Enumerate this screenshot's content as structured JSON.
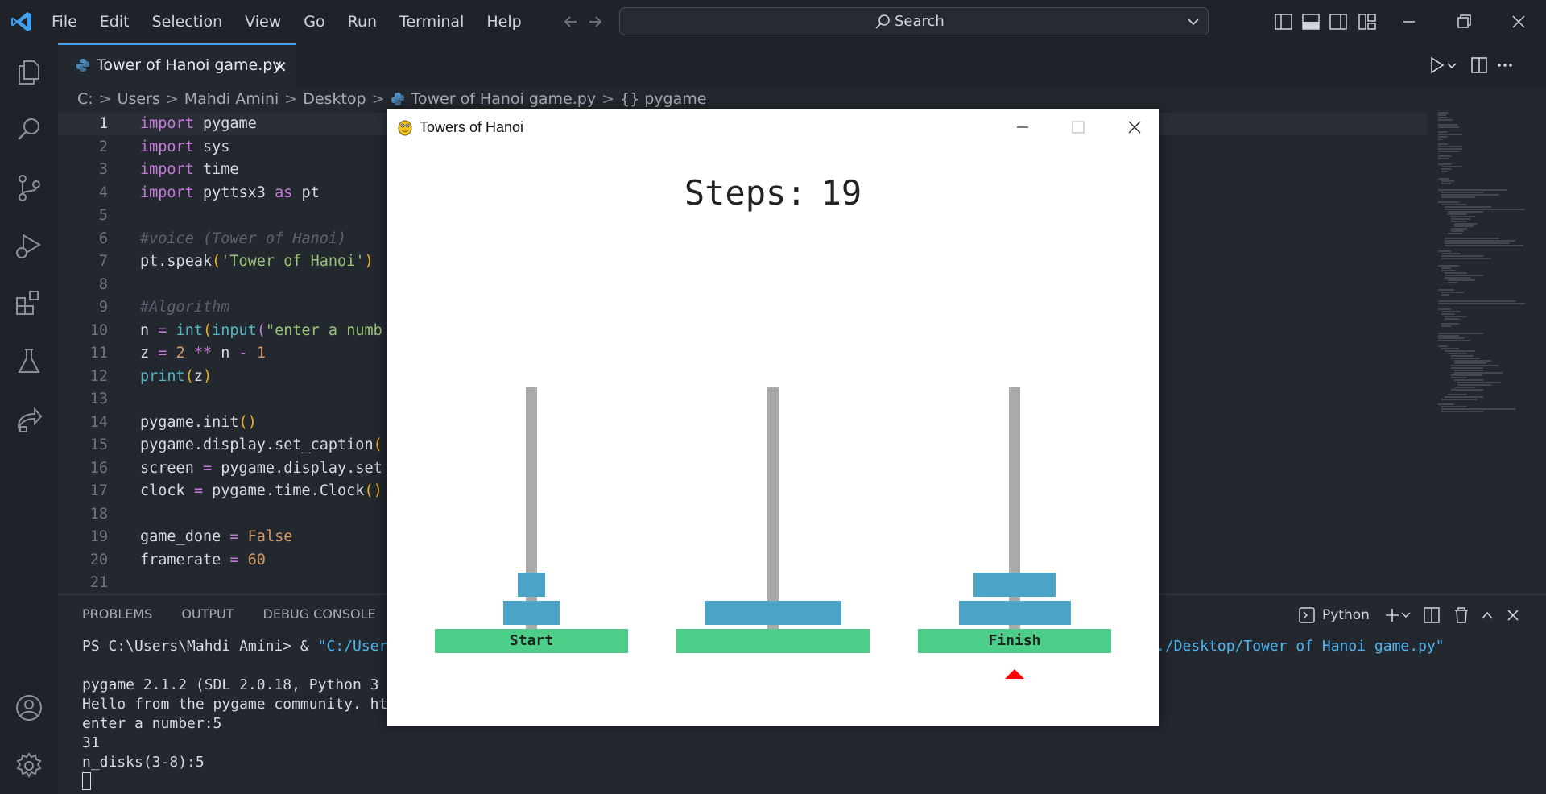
{
  "menu": [
    "File",
    "Edit",
    "Selection",
    "View",
    "Go",
    "Run",
    "Terminal",
    "Help"
  ],
  "search": {
    "label": "Search"
  },
  "tab": {
    "label": "Tower of Hanoi game.py",
    "close": "✕"
  },
  "breadcrumb": {
    "items": [
      "C:",
      "Users",
      "Mahdi Amini",
      "Desktop",
      "Tower of Hanoi game.py",
      "{} pygame"
    ],
    "separator": ">"
  },
  "code_lines": [
    {
      "n": "1"
    },
    {
      "n": "2"
    },
    {
      "n": "3"
    },
    {
      "n": "4"
    },
    {
      "n": "5"
    },
    {
      "n": "6"
    },
    {
      "n": "7"
    },
    {
      "n": "8"
    },
    {
      "n": "9"
    },
    {
      "n": "10"
    },
    {
      "n": "11"
    },
    {
      "n": "12"
    },
    {
      "n": "13"
    },
    {
      "n": "14"
    },
    {
      "n": "15"
    },
    {
      "n": "16"
    },
    {
      "n": "17"
    },
    {
      "n": "18"
    },
    {
      "n": "19"
    },
    {
      "n": "20"
    },
    {
      "n": "21"
    }
  ],
  "code": {
    "l1_kw": "import",
    "l1_mod": " pygame",
    "l2_kw": "import",
    "l2_mod": " sys",
    "l3_kw": "import",
    "l3_mod": " time",
    "l4_kw": "import",
    "l4_mod": " pyttsx3 ",
    "l4_as": "as",
    "l4_alias": " pt",
    "l6_cmt": "#voice (Tower of Hanoi)",
    "l7_a": "pt.speak",
    "l7_p1": "(",
    "l7_str": "'Tower of Hanoi'",
    "l7_p2": ")",
    "l9_cmt": "#Algorithm",
    "l10_a": "n ",
    "l10_eq": "=",
    "l10_sp": " ",
    "l10_int": "int",
    "l10_p": "(",
    "l10_input": "input",
    "l10_p2": "(",
    "l10_str": "\"enter a numb",
    "l11_a": "z ",
    "l11_eq": "=",
    "l11_sp": " ",
    "l11_two": "2",
    "l11_pow": " ** ",
    "l11_n": "n ",
    "l11_minus": "-",
    "l11_one": " 1",
    "l12_print": "print",
    "l12_p": "(",
    "l12_z": "z",
    "l12_p2": ")",
    "l14_a": "pygame.init",
    "l14_p": "()",
    "l15_a": "pygame.display.set_caption",
    "l15_p": "(",
    "l16_a": "screen ",
    "l16_eq": "=",
    "l16_b": " pygame.display.set",
    "l17_a": "clock ",
    "l17_eq": "=",
    "l17_b": " pygame.time.Clock",
    "l17_p": "()",
    "l19_a": "game_done ",
    "l19_eq": "=",
    "l19_val": " False",
    "l20_a": "framerate ",
    "l20_eq": "=",
    "l20_val": " 60"
  },
  "panel": {
    "tabs": [
      "PROBLEMS",
      "OUTPUT",
      "DEBUG CONSOLE"
    ],
    "terminal_label": "Python"
  },
  "terminal": {
    "line1_prompt": "PS C:\\Users\\Mahdi Amini> & ",
    "line1_path": "\"C:/User",
    "line1_tail": "./Desktop/Tower of Hanoi game.py\"",
    "line3": "pygame 2.1.2 (SDL 2.0.18, Python 3",
    "line4": "Hello from the pygame community. ht",
    "line5": "enter a number:5",
    "line6": "31",
    "line7": "n_disks(3-8):5"
  },
  "pygame_window": {
    "title": "Towers of Hanoi",
    "steps_label": "Steps:",
    "steps_value": "19",
    "base_labels": [
      "Start",
      "",
      "Finish"
    ],
    "pegs": [
      {
        "disks": [
          2,
          1
        ]
      },
      {
        "disks": [
          4
        ]
      },
      {
        "disks": [
          3,
          2
        ]
      }
    ],
    "marker_under": "Finish",
    "colors": {
      "peg": "#aaaaaa",
      "base": "#4bcf88",
      "disk": "#4ba3c7",
      "marker": "#ff0000"
    }
  }
}
